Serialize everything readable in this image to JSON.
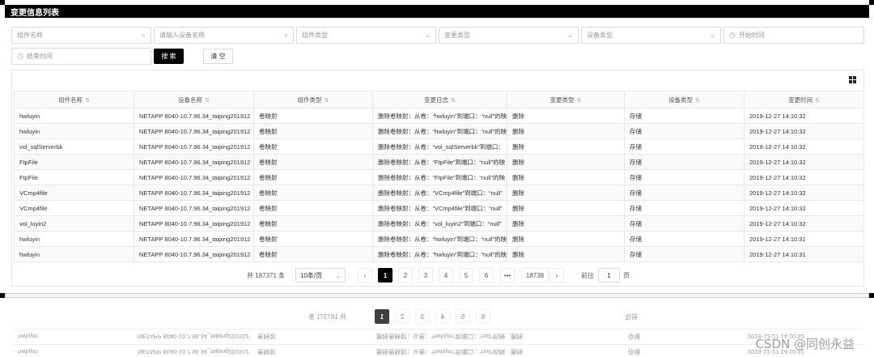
{
  "page": {
    "title": "变更信息列表"
  },
  "filters": {
    "component_name_placeholder": "组件名称",
    "device_name_placeholder": "请输入设备名称",
    "component_type_placeholder": "组件类型",
    "change_type_placeholder": "变更类型",
    "device_type_placeholder": "设备类型",
    "start_time_placeholder": "开始时间",
    "end_time_placeholder": "结束时间",
    "search_label": "搜 索",
    "clear_label": "清 空"
  },
  "table": {
    "columns": [
      "组件名称",
      "设备名称",
      "组件类型",
      "变更日志",
      "变更类型",
      "设备类型",
      "变更时间"
    ],
    "rows": [
      [
        "hwluyin",
        "NETAPP 8040-10.7.96.34_taiping201912",
        "卷映射",
        "删除卷映射：从卷：“hwluyin”到端口：“null”的映",
        "删除",
        "存储",
        "2019-12-27 14:10:32"
      ],
      [
        "hwluyin",
        "NETAPP 8040-10.7.96.34_taiping201912",
        "卷映射",
        "删除卷映射：从卷：“hwluyin”到端口：“null”的映",
        "删除",
        "存储",
        "2019-12-27 14:10:32"
      ],
      [
        "vol_sqlServerbk",
        "NETAPP 8040-10.7.96.34_taiping201912",
        "卷映射",
        "删除卷映射：从卷：“vol_sqlServerbk”到端口：",
        "删除",
        "存储",
        "2019-12-27 14:10:32"
      ],
      [
        "FtpFile",
        "NETAPP 8040-10.7.96.34_taiping201912",
        "卷映射",
        "删除卷映射：从卷：“FtpFile”到端口：“null”的映",
        "删除",
        "存储",
        "2019-12-27 14:10:32"
      ],
      [
        "FtpFile",
        "NETAPP 8040-10.7.96.34_taiping201912",
        "卷映射",
        "删除卷映射：从卷：“FtpFile”到端口：“null”的映",
        "删除",
        "存储",
        "2019-12-27 14:10:32"
      ],
      [
        "VCmp4file",
        "NETAPP 8040-10.7.96.34_taiping201912",
        "卷映射",
        "删除卷映射：从卷：“VCmp4file”到端口：“null”",
        "删除",
        "存储",
        "2019-12-27 14:10:32"
      ],
      [
        "VCmp4file",
        "NETAPP 8040-10.7.96.34_taiping201912",
        "卷映射",
        "删除卷映射：从卷：“VCmp4file”到端口：“null”",
        "删除",
        "存储",
        "2019-12-27 14:10:32"
      ],
      [
        "vol_luyin2",
        "NETAPP 8040-10.7.96.34_taiping201912",
        "卷映射",
        "删除卷映射：从卷：“vol_luyin2”到端口：“null”",
        "删除",
        "存储",
        "2019-12-27 14:10:32"
      ],
      [
        "hwluyin",
        "NETAPP 8040-10.7.96.34_taiping201912",
        "卷映射",
        "删除卷映射：从卷：“hwluyin”到端口：“null”的映",
        "删除",
        "存储",
        "2019-12-27 14:10:31"
      ],
      [
        "hwluyin",
        "NETAPP 8040-10.7.96.34_taiping201912",
        "卷映射",
        "删除卷映射：从卷：“hwluyin”到端口：“null”的映",
        "删除",
        "存储",
        "2019-12-27 14:10:31"
      ]
    ]
  },
  "pagination": {
    "total_text": "共 187371 条",
    "page_size": "10条/页",
    "pages": [
      "1",
      "2",
      "3",
      "4",
      "5",
      "6"
    ],
    "ellipsis": "•••",
    "last_page": "18738",
    "prev": "‹",
    "next": "›",
    "goto_label": "前往",
    "goto_value": "1",
    "goto_suffix": "页"
  },
  "watermark": "CSDN @同创永益",
  "colors": {
    "title_bg": "#000000",
    "active_page": "#000000",
    "border": "#d9d9d9"
  }
}
